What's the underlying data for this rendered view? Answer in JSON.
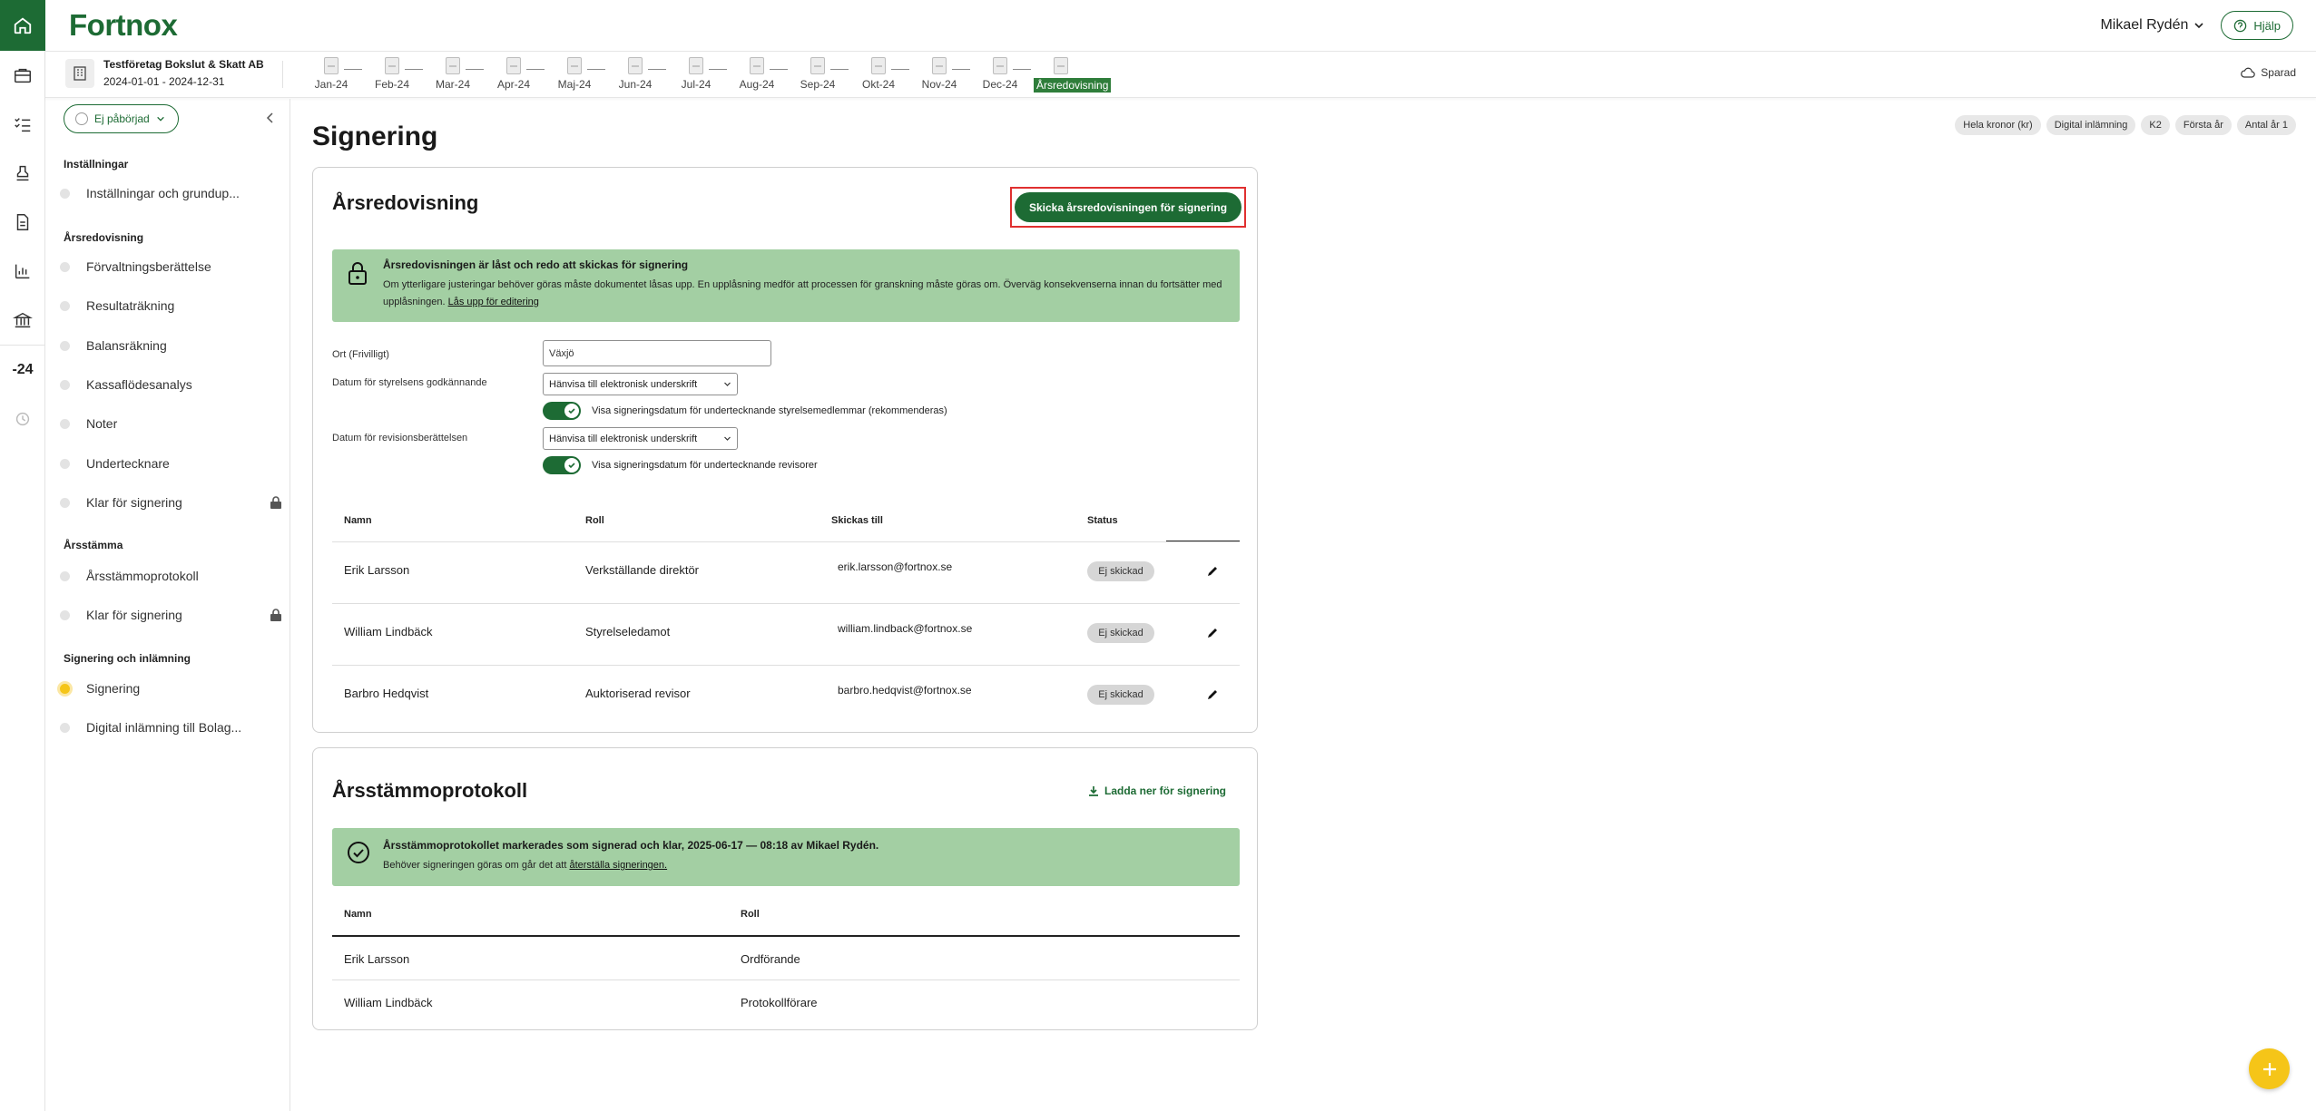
{
  "brand": {
    "logo": "Fortnox",
    "accent": "#1d6b34",
    "highlight": "#f5c518"
  },
  "rail": {
    "year_badge": "-24"
  },
  "header": {
    "user_name": "Mikael Rydén",
    "help_label": "Hjälp"
  },
  "company": {
    "name": "Testföretag Bokslut & Skatt AB",
    "period": "2024-01-01 - 2024-12-31"
  },
  "months": [
    "Jan-24",
    "Feb-24",
    "Mar-24",
    "Apr-24",
    "Maj-24",
    "Jun-24",
    "Jul-24",
    "Aug-24",
    "Sep-24",
    "Okt-24",
    "Nov-24",
    "Dec-24",
    "Årsredovisning"
  ],
  "saved_label": "Sparad",
  "sidebar": {
    "status_label": "Ej påbörjad",
    "sections": [
      {
        "heading": "Inställningar",
        "items": [
          {
            "label": "Inställningar och grundup..."
          }
        ]
      },
      {
        "heading": "Årsredovisning",
        "items": [
          {
            "label": "Förvaltningsberättelse"
          },
          {
            "label": "Resultaträkning"
          },
          {
            "label": "Balansräkning"
          },
          {
            "label": "Kassaflödesanalys"
          },
          {
            "label": "Noter"
          },
          {
            "label": "Undertecknare"
          },
          {
            "label": "Klar för signering"
          }
        ]
      },
      {
        "heading": "Årsstämma",
        "items": [
          {
            "label": "Årsstämmoprotokoll"
          },
          {
            "label": "Klar för signering"
          }
        ]
      },
      {
        "heading": "Signering och inlämning",
        "items": [
          {
            "label": "Signering"
          },
          {
            "label": "Digital inlämning till Bolag..."
          }
        ]
      }
    ]
  },
  "tags": [
    "Hela kronor (kr)",
    "Digital inlämning",
    "K2",
    "Första år",
    "Antal år 1"
  ],
  "page_title": "Signering",
  "annual_report": {
    "title": "Årsredovisning",
    "send_button": "Skicka årsredovisningen för signering",
    "banner_title": "Årsredovisningen är låst och redo att skickas för signering",
    "banner_text": "Om ytterligare justeringar behöver göras måste dokumentet låsas upp. En upplåsning medför att processen för granskning måste göras om. Överväg konsekvenserna innan du fortsätter med upplåsningen.",
    "banner_link": "Lås upp för editering",
    "ort_label": "Ort (Frivilligt)",
    "ort_value": "Växjö",
    "board_date_label": "Datum för styrelsens godkännande",
    "board_date_value": "Hänvisa till elektronisk underskrift",
    "board_toggle_label": "Visa signeringsdatum för undertecknande styrelsemedlemmar (rekommenderas)",
    "audit_date_label": "Datum för revisionsberättelsen",
    "audit_date_value": "Hänvisa till elektronisk underskrift",
    "audit_toggle_label": "Visa signeringsdatum för undertecknande revisorer",
    "columns": [
      "Namn",
      "Roll",
      "Skickas till",
      "Status"
    ],
    "rows": [
      {
        "name": "Erik Larsson",
        "role": "Verkställande direktör",
        "email": "erik.larsson@fortnox.se",
        "status": "Ej skickad"
      },
      {
        "name": "William Lindbäck",
        "role": "Styrelseledamot",
        "email": "william.lindback@fortnox.se",
        "status": "Ej skickad"
      },
      {
        "name": "Barbro Hedqvist",
        "role": "Auktoriserad revisor",
        "email": "barbro.hedqvist@fortnox.se",
        "status": "Ej skickad"
      }
    ]
  },
  "agm": {
    "title": "Årsstämmoprotokoll",
    "download_label": "Ladda ner för signering",
    "banner_title": "Årsstämmoprotokollet markerades som signerad och klar, 2025-06-17 — 08:18 av Mikael Rydén.",
    "banner_text": "Behöver signeringen göras om går det att",
    "banner_link": "återställa signeringen.",
    "columns": [
      "Namn",
      "Roll"
    ],
    "rows": [
      {
        "name": "Erik Larsson",
        "role": "Ordförande"
      },
      {
        "name": "William Lindbäck",
        "role": "Protokollförare"
      }
    ]
  }
}
